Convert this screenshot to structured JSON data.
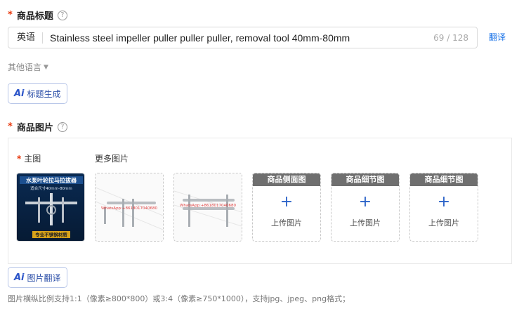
{
  "product_title": {
    "label": "商品标题",
    "language": "英语",
    "value": "Stainless steel impeller puller puller puller, removal tool 40mm-80mm",
    "count": "69 / 128",
    "translate": "翻译",
    "other_languages": "其他语言",
    "ai_button": "标题生成"
  },
  "product_images": {
    "label": "商品图片",
    "main_label": "主图",
    "more_label": "更多图片",
    "main_image_texts": [
      "水泵叶轮拉马拉拔器",
      "适合尺寸40mm-80mm",
      "专业不锈钢材质"
    ],
    "watermark": "WhatsApp:+8618017040680",
    "slots": [
      {
        "heading": "商品侧面图",
        "upload": "上传图片"
      },
      {
        "heading": "商品细节图",
        "upload": "上传图片"
      },
      {
        "heading": "商品细节图",
        "upload": "上传图片"
      }
    ],
    "ai_button": "图片翻译",
    "hint": "图片横纵比例支持1:1（像素≥800*800）或3:4（像素≥750*1000），支持jpg、jpeg、png格式；"
  },
  "ai_badge": "Ai",
  "colors": {
    "accent": "#1a73e8",
    "required": "#e8380d",
    "slot_header": "#6f6f6f"
  }
}
